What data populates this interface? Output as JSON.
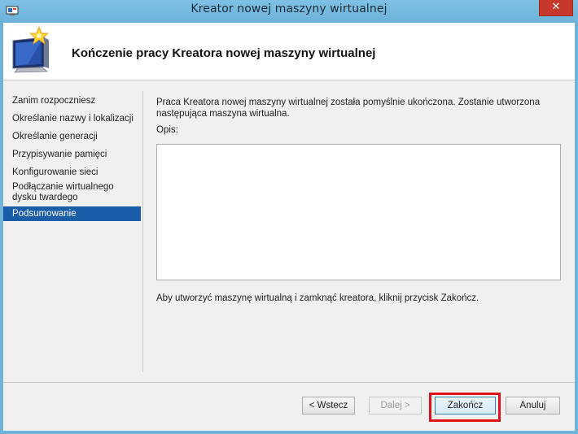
{
  "window": {
    "title": "Kreator nowej maszyny wirtualnej",
    "close_glyph": "✕"
  },
  "header": {
    "title": "Kończenie pracy Kreatora nowej maszyny wirtualnej",
    "icon": "computer-wizard-icon"
  },
  "nav": {
    "items": [
      {
        "label": "Zanim rozpoczniesz"
      },
      {
        "label": "Określanie nazwy i lokalizacji"
      },
      {
        "label": "Określanie generacji"
      },
      {
        "label": "Przypisywanie pamięci"
      },
      {
        "label": "Konfigurowanie sieci"
      },
      {
        "label": "Podłączanie wirtualnego dysku twardego"
      },
      {
        "label": "Podsumowanie",
        "selected": true
      }
    ]
  },
  "main": {
    "intro": "Praca Kreatora nowej maszyny wirtualnej została pomyślnie ukończona. Zostanie utworzona następująca maszyna wirtualna.",
    "description_label": "Opis:",
    "description_value": "",
    "footer": "Aby utworzyć maszynę wirtualną i zamknąć kreatora, kliknij przycisk Zakończ."
  },
  "buttons": {
    "back": "< Wstecz",
    "next": "Dalej >",
    "finish": "Zakończ",
    "cancel": "Anuluj"
  },
  "colors": {
    "titlebar": "#6fb3d9",
    "selection": "#1a5da8",
    "close": "#c7382c",
    "highlight": "#e0111a"
  }
}
